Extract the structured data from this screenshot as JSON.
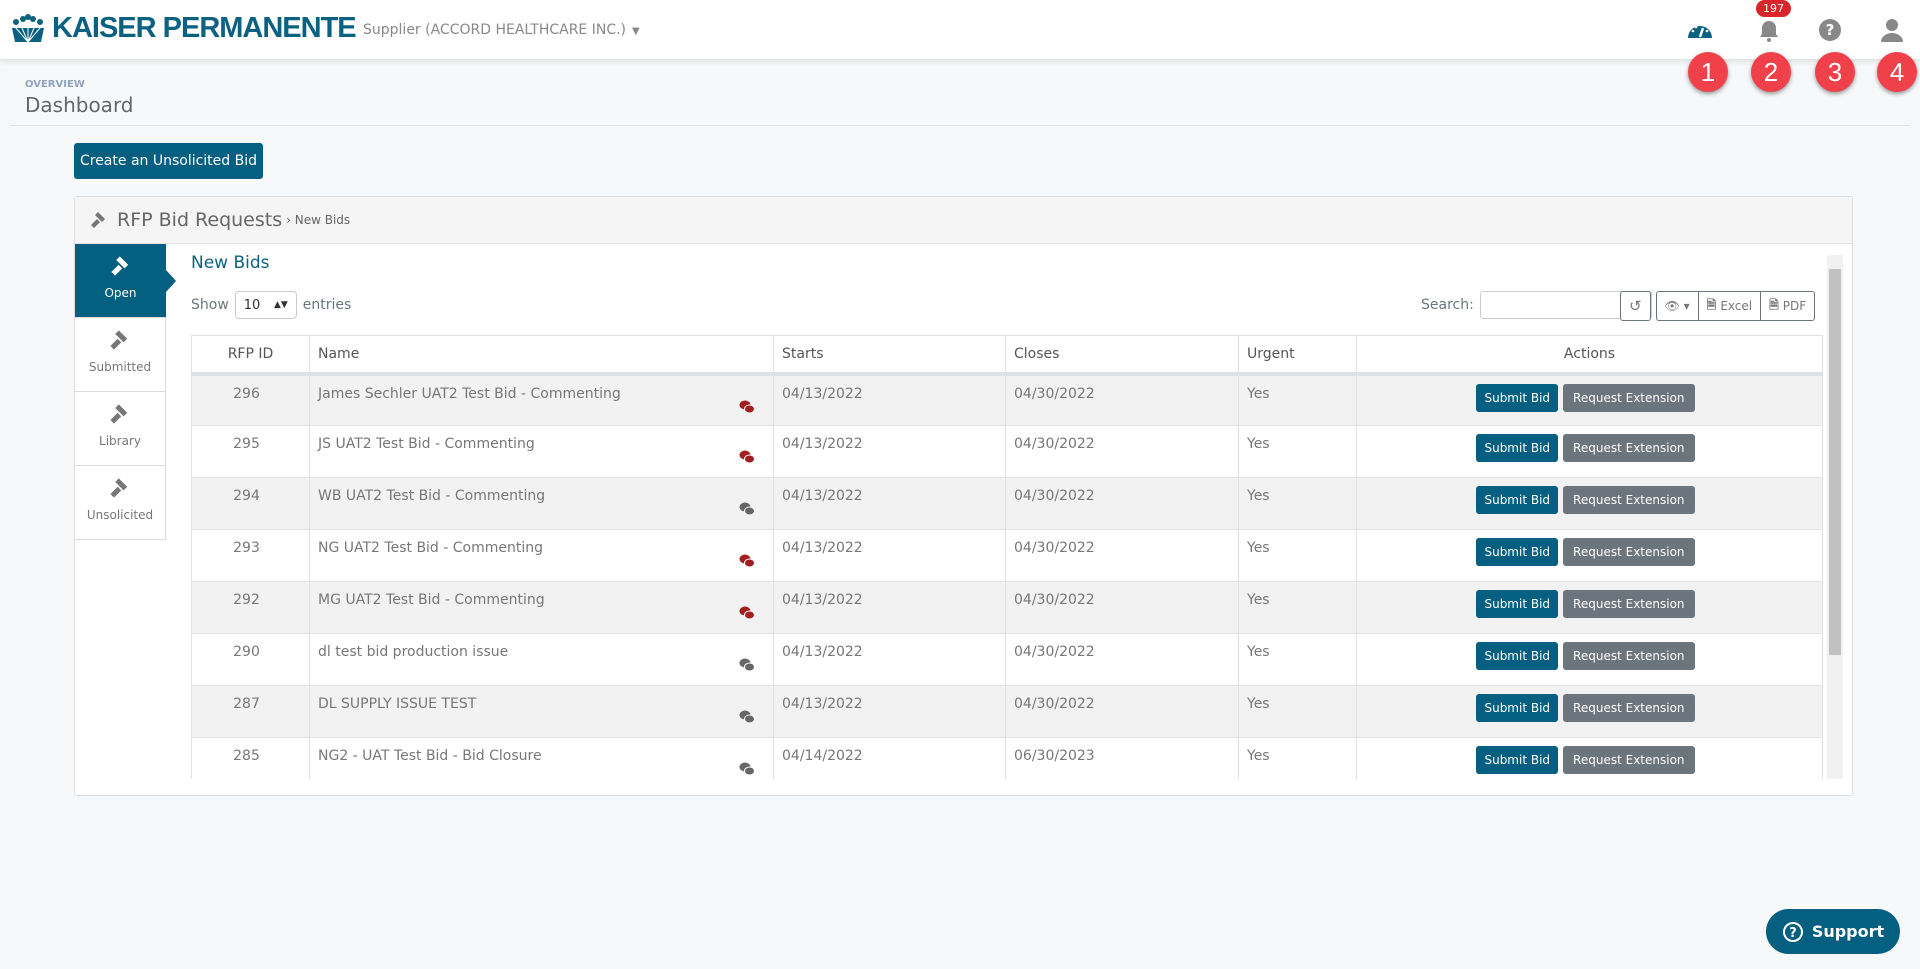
{
  "header": {
    "logo": "KAISER PERMANENTE",
    "supplier": "Supplier (ACCORD HEALTHCARE INC.)",
    "notification_count": "197",
    "markers": [
      "1",
      "2",
      "3",
      "4"
    ]
  },
  "page": {
    "overview": "OVERVIEW",
    "title": "Dashboard",
    "create_button": "Create an Unsolicited Bid"
  },
  "panel": {
    "title": "RFP Bid Requests",
    "breadcrumb": "› New Bids",
    "subtitle": "New Bids",
    "tabs": [
      {
        "label": "Open"
      },
      {
        "label": "Submitted"
      },
      {
        "label": "Library"
      },
      {
        "label": "Unsolicited"
      }
    ],
    "show": "Show",
    "entries_value": "10",
    "entries": "entries",
    "search_label": "Search:",
    "search_value": "",
    "excel": "Excel",
    "pdf": "PDF",
    "columns": [
      "RFP ID",
      "Name",
      "Starts",
      "Closes",
      "Urgent",
      "Actions"
    ],
    "submit_label": "Submit Bid",
    "extension_label": "Request Extension",
    "rows": [
      {
        "id": "296",
        "name": "James Sechler UAT2 Test Bid - Commenting",
        "starts": "04/13/2022",
        "closes": "04/30/2022",
        "urgent": "Yes",
        "comment_color": "#a31f1f"
      },
      {
        "id": "295",
        "name": "JS UAT2 Test Bid - Commenting",
        "starts": "04/13/2022",
        "closes": "04/30/2022",
        "urgent": "Yes",
        "comment_color": "#a31f1f"
      },
      {
        "id": "294",
        "name": "WB UAT2 Test Bid - Commenting",
        "starts": "04/13/2022",
        "closes": "04/30/2022",
        "urgent": "Yes",
        "comment_color": "#666666"
      },
      {
        "id": "293",
        "name": "NG UAT2 Test Bid - Commenting",
        "starts": "04/13/2022",
        "closes": "04/30/2022",
        "urgent": "Yes",
        "comment_color": "#a31f1f"
      },
      {
        "id": "292",
        "name": "MG UAT2 Test Bid - Commenting",
        "starts": "04/13/2022",
        "closes": "04/30/2022",
        "urgent": "Yes",
        "comment_color": "#a31f1f"
      },
      {
        "id": "290",
        "name": "dl test bid production issue",
        "starts": "04/13/2022",
        "closes": "04/30/2022",
        "urgent": "Yes",
        "comment_color": "#666666"
      },
      {
        "id": "287",
        "name": "DL SUPPLY ISSUE TEST",
        "starts": "04/13/2022",
        "closes": "04/30/2022",
        "urgent": "Yes",
        "comment_color": "#666666"
      },
      {
        "id": "285",
        "name": "NG2 - UAT Test Bid - Bid Closure",
        "starts": "04/14/2022",
        "closes": "06/30/2023",
        "urgent": "Yes",
        "comment_color": "#666666"
      }
    ]
  },
  "support": "Support",
  "colors": {
    "brand": "#055f80",
    "badge": "#d9262c",
    "marker": "#f0404a"
  }
}
